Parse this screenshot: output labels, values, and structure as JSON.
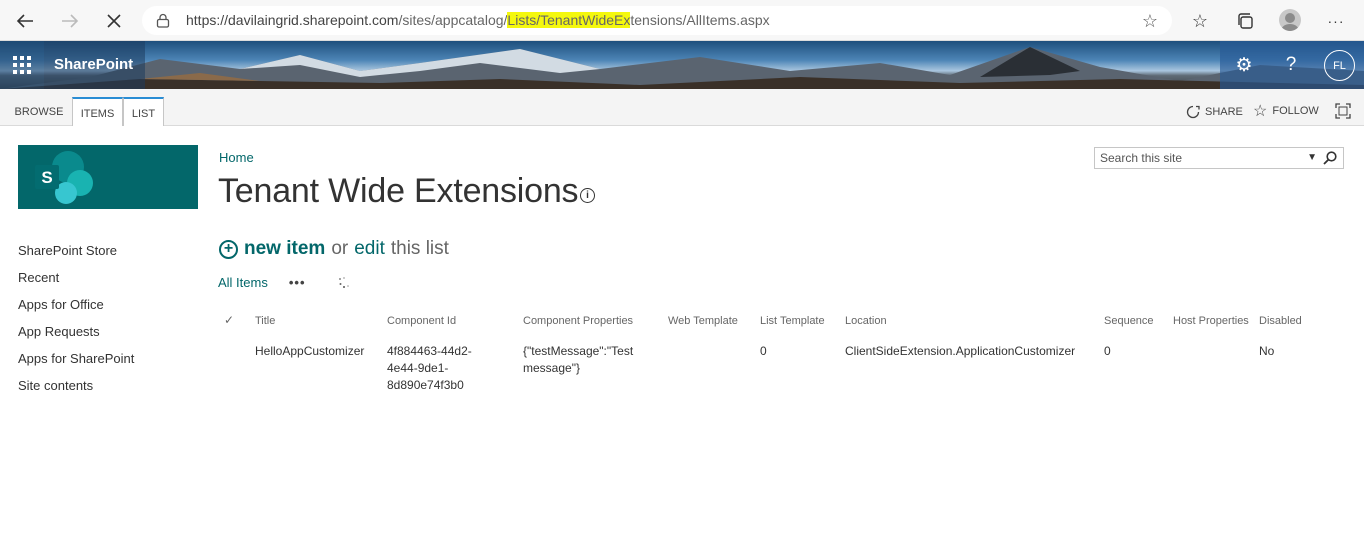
{
  "browser": {
    "url_host": "https://davilaingrid.sharepoint.com",
    "url_path_start": "/sites/appcatalog/",
    "url_highlight": "Lists/TenantWideEx",
    "url_path_end": "tensions/AllItems.aspx"
  },
  "suite": {
    "brand": "SharePoint",
    "user_initials": "FL"
  },
  "ribbon": {
    "tabs": [
      {
        "label": "BROWSE"
      },
      {
        "label": "ITEMS"
      },
      {
        "label": "LIST"
      }
    ],
    "share_label": "SHARE",
    "follow_label": "FOLLOW"
  },
  "site_logo_letter": "S",
  "quick_launch": [
    "SharePoint Store",
    "Recent",
    "Apps for Office",
    "App Requests",
    "Apps for SharePoint",
    "Site contents"
  ],
  "breadcrumb": "Home",
  "page_title": "Tenant Wide Extensions",
  "new_item": {
    "new_label": "new item",
    "or_text": "or",
    "edit_label": "edit",
    "this_list_text": "this list"
  },
  "view": {
    "name": "All Items",
    "more": "•••"
  },
  "search": {
    "placeholder": "Search this site"
  },
  "table": {
    "columns": [
      "Title",
      "Component Id",
      "Component Properties",
      "Web Template",
      "List Template",
      "Location",
      "Sequence",
      "Host Properties",
      "Disabled"
    ],
    "rows": [
      {
        "title": "HelloAppCustomizer",
        "component_id": "4f884463-44d2-4e44-9de1-8d890e74f3b0",
        "component_properties": "{\"testMessage\":\"Test message\"}",
        "web_template": "",
        "list_template": "0",
        "location": "ClientSideExtension.ApplicationCustomizer",
        "sequence": "0",
        "host_properties": "",
        "disabled": "No"
      }
    ]
  },
  "colors": {
    "accent": "#03676a",
    "url_highlight": "#f4f80e",
    "ribbon_selected_border": "#2a8dd4"
  }
}
